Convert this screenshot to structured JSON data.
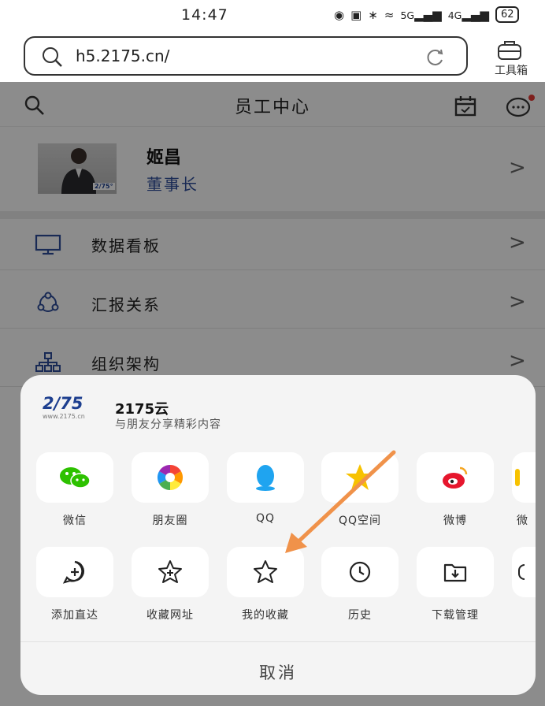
{
  "status_bar": {
    "time": "14:47",
    "signal_5g": "5G",
    "signal_4g": "4G",
    "battery": "62"
  },
  "browser": {
    "url": "h5.2175.cn/",
    "toolbox_label": "工具箱"
  },
  "page": {
    "title": "员工中心",
    "profile": {
      "name": "姬昌",
      "role": "董事长",
      "avatar_logo": "2/75°"
    },
    "menu": [
      {
        "label": "数据看板",
        "icon": "monitor-icon"
      },
      {
        "label": "汇报关系",
        "icon": "relation-icon"
      },
      {
        "label": "组织架构",
        "icon": "org-chart-icon"
      }
    ],
    "chevron": ">"
  },
  "share_sheet": {
    "logo_text": "2/75",
    "logo_sub": "www.2175.cn",
    "title": "2175云",
    "subtitle": "与朋友分享精彩内容",
    "share_targets": [
      {
        "label": "微信",
        "icon": "wechat-icon"
      },
      {
        "label": "朋友圈",
        "icon": "moments-icon"
      },
      {
        "label": "QQ",
        "icon": "qq-icon"
      },
      {
        "label": "QQ空间",
        "icon": "qzone-icon"
      },
      {
        "label": "微博",
        "icon": "weibo-icon"
      },
      {
        "label": "微",
        "icon": "wechat-icon"
      }
    ],
    "actions": [
      {
        "label": "添加直达",
        "icon": "add-shortcut-icon"
      },
      {
        "label": "收藏网址",
        "icon": "add-favorite-icon"
      },
      {
        "label": "我的收藏",
        "icon": "favorites-icon"
      },
      {
        "label": "历史",
        "icon": "history-icon"
      },
      {
        "label": "下载管理",
        "icon": "download-icon"
      },
      {
        "label": "",
        "icon": "more-icon"
      }
    ],
    "cancel": "取消"
  },
  "colors": {
    "accent_blue": "#2f4e9b",
    "wechat_green": "#2dc100",
    "qq_blue": "#1fa4f0",
    "qzone_yellow": "#f7c200",
    "weibo_red": "#e6162d",
    "annotation_arrow": "#f0924a"
  }
}
